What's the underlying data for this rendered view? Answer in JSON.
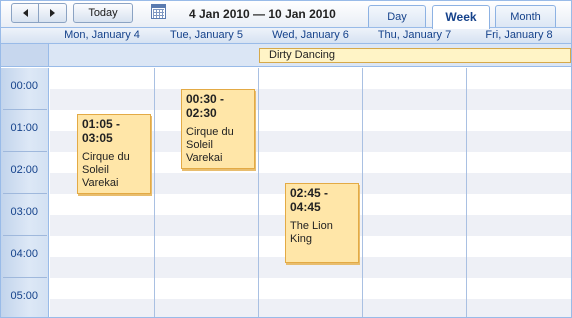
{
  "toolbar": {
    "today_label": "Today",
    "date_range": "4 Jan 2010 — 10 Jan 2010",
    "prev_icon": "chevron-left-icon",
    "next_icon": "chevron-right-icon",
    "calendar_icon": "calendar-icon"
  },
  "view_tabs": [
    {
      "label": "Day",
      "active": false
    },
    {
      "label": "Week",
      "active": true
    },
    {
      "label": "Month",
      "active": false
    }
  ],
  "days": [
    "Mon, January 4",
    "Tue, January 5",
    "Wed, January 6",
    "Thu, January 7",
    "Fri, January 8"
  ],
  "all_day_events": [
    {
      "title": "Dirty Dancing"
    }
  ],
  "time_slots": [
    "00:00",
    "01:00",
    "02:00",
    "03:00",
    "04:00",
    "05:00"
  ],
  "events": [
    {
      "time": "01:05 - 03:05",
      "title": "Cirque du Soleil Varekai",
      "day": "Mon, January 4"
    },
    {
      "time": "00:30 - 02:30",
      "title": "Cirque du Soleil Varekai",
      "day": "Tue, January 5"
    },
    {
      "time": "02:45 - 04:45",
      "title": "The Lion King",
      "day": "Wed, January 6"
    }
  ],
  "colors": {
    "accent_border": "#99bbe8",
    "header_text": "#15428b",
    "event_fill": "#ffe6a8",
    "event_border": "#e3aa45",
    "allday_event_fill": "#fff4c6"
  }
}
